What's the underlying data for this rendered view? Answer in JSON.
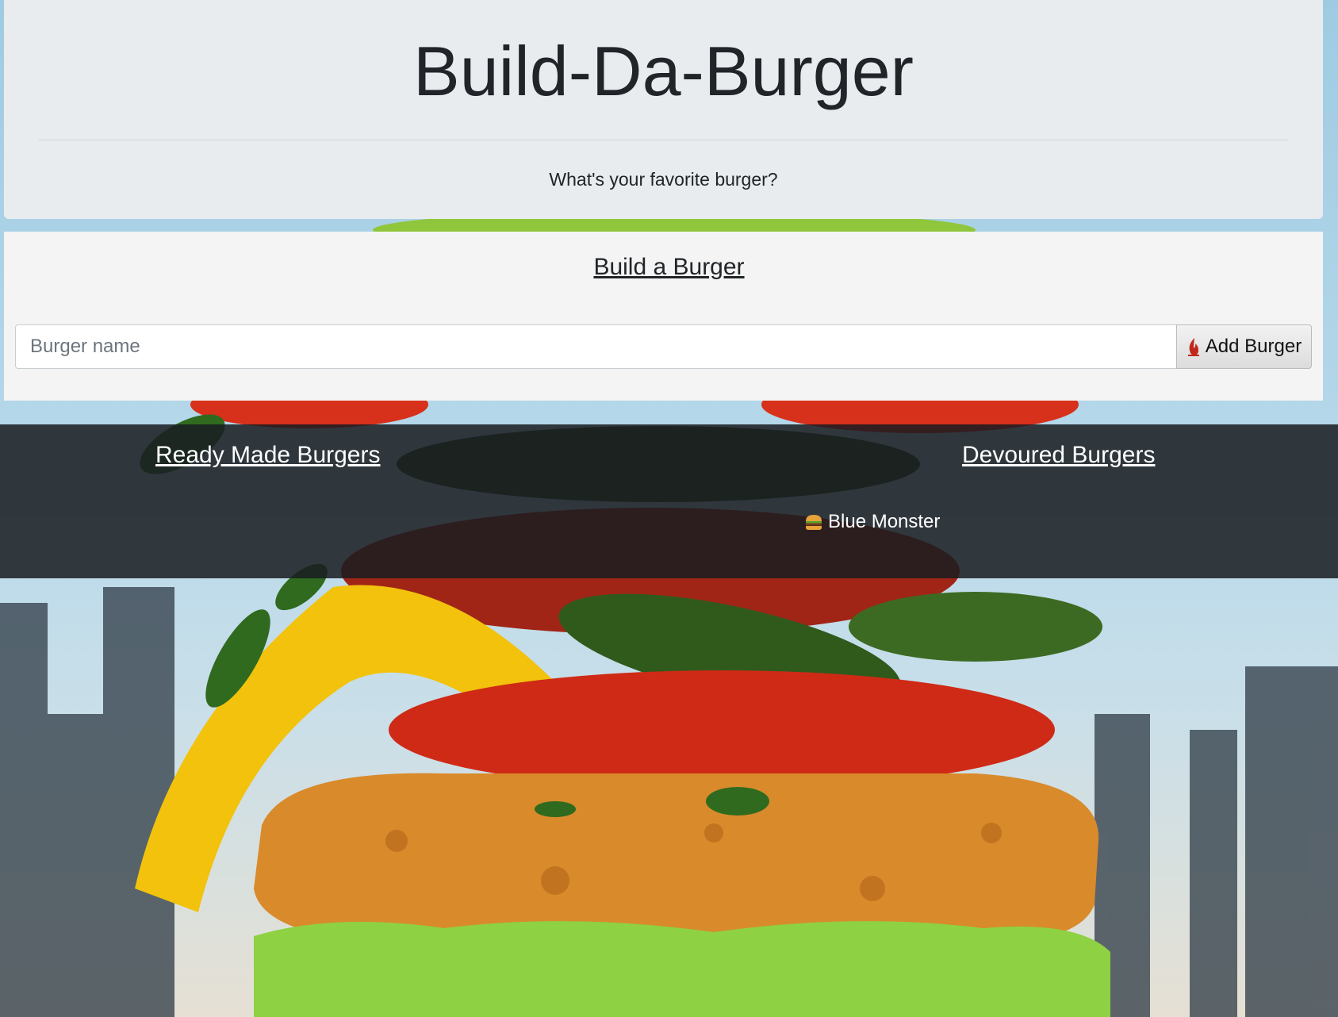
{
  "header": {
    "title": "Build-Da-Burger",
    "tagline": "What's your favorite burger?"
  },
  "build": {
    "heading": "Build a Burger",
    "input_placeholder": "Burger name",
    "input_value": "",
    "add_button_label": "Add Burger",
    "add_button_icon": "fire-icon"
  },
  "burgers": {
    "ready_heading": "Ready Made Burgers",
    "ready_items": [],
    "devoured_heading": "Devoured Burgers",
    "devoured_items": [
      {
        "name": "Blue Monster",
        "icon": "burger-icon"
      }
    ]
  },
  "colors": {
    "jumbotron_bg": "#e8ecef",
    "panel_bg": "#f4f4f4",
    "dark_section_bg": "#181c21",
    "text": "#212529"
  }
}
